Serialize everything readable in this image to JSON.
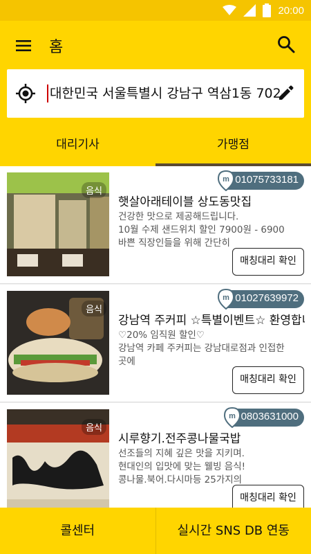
{
  "status_bar": {
    "time": "20:00"
  },
  "app_bar": {
    "title": "홈"
  },
  "location": {
    "address": "대한민국 서울특별시 강남구 역삼1동 702-"
  },
  "tabs": [
    {
      "label": "대리기사",
      "selected": false
    },
    {
      "label": "가맹점",
      "selected": true
    }
  ],
  "cards": [
    {
      "tag": "음식",
      "phone": "01075733181",
      "title": "햇살아래테이블 상도동맛집",
      "lines": [
        "건강한 맛으로 제공해드립니다.",
        "10월 수제 샌드위치 할인 7900원 - 6900",
        "바쁜 직장인들을 위해 간단히"
      ],
      "button": "매칭대리 확인"
    },
    {
      "tag": "음식",
      "phone": "01027639972",
      "title": "강남역 주커피 ☆특별이벤트☆ 환영합니다",
      "lines": [
        "♡20% 임직원 할인♡",
        "강남역 카페 주커피는 강남대로점과 인접한",
        "곳에"
      ],
      "button": "매칭대리 확인"
    },
    {
      "tag": "음식",
      "phone": "0803631000",
      "title": "시루향기.전주콩나물국밥",
      "lines": [
        "선조들의 지혜 깊은 맛을 지키며.",
        "현대인의 입맛에 맞는 웰빙 음식!",
        "콩나물.북어.다시마등 25가지의"
      ],
      "button": "매칭대리 확인"
    }
  ],
  "bottom": {
    "left": "콜센터",
    "right": "실시간 SNS DB 연동"
  }
}
